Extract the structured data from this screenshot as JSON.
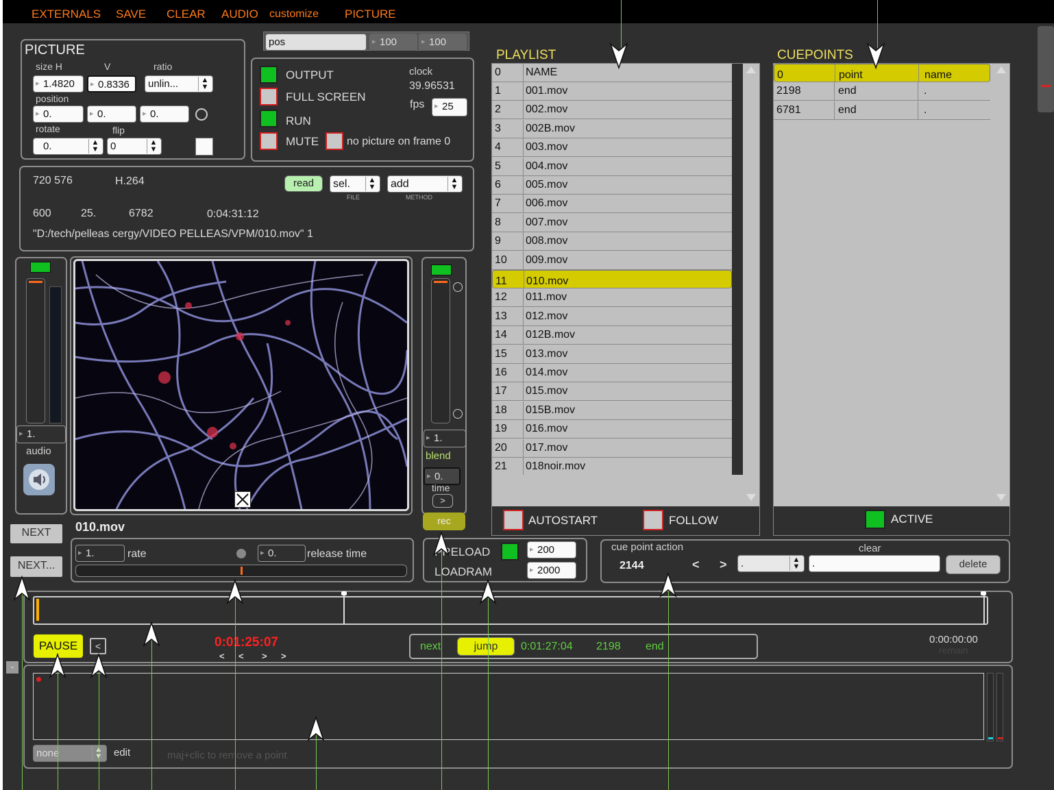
{
  "menu": [
    "EXTERNALS",
    "SAVE",
    "CLEAR",
    "AUDIO",
    "customize",
    "PICTURE"
  ],
  "picture": {
    "title": "PICTURE",
    "size_h_label": "size H",
    "v_label": "V",
    "ratio_label": "ratio",
    "size_h": "1.4820",
    "v": "0.8336",
    "ratio": "unlin...",
    "position_label": "position",
    "pos_x": "0.",
    "pos_y": "0.",
    "pos_z": "0.",
    "rotate_label": "rotate",
    "flip_label": "flip",
    "rotate": "0.",
    "flip": "0"
  },
  "posbar": {
    "mode": "pos",
    "a": "100",
    "b": "100"
  },
  "output": {
    "output_label": "OUTPUT",
    "fullscreen_label": "FULL SCREEN",
    "run_label": "RUN",
    "mute_label": "MUTE",
    "noframe_label": "no picture on frame 0",
    "clock_label": "clock",
    "clock_value": "39.96531",
    "fps_label": "fps",
    "fps_value": "25"
  },
  "info": {
    "resolution": "720 576",
    "codec": "H.264",
    "read_label": "read",
    "file_select": "sel.",
    "method_select": "add",
    "file_label": "FILE",
    "method_label": "METHOD",
    "v1": "600",
    "v2": "25.",
    "v3": "6782",
    "duration": "0:04:31:12",
    "path": "\"D:/tech/pelleas cergy/VIDEO PELLEAS/VPM/010.mov\" 1"
  },
  "audio": {
    "value": "1.",
    "label": "audio"
  },
  "blend": {
    "value": "1.",
    "label": "blend",
    "time_value": "0.",
    "time_label": "time",
    "arrow": ">",
    "rec_label": "rec"
  },
  "preview": {
    "filename": "010.mov"
  },
  "next_buttons": [
    "NEXT",
    "NEXT..."
  ],
  "rate": {
    "value": "1.",
    "label": "rate",
    "release_value": "0.",
    "release_label": "release time",
    "progress": 0.5
  },
  "preload": {
    "preload_label": "PRELOAD",
    "preload_value": "200",
    "loadram_label": "LOADRAM",
    "loadram_value": "2000"
  },
  "cue_action": {
    "title": "cue point action",
    "clear_label": "clear",
    "value": "2144",
    "prev": "<",
    "next": ">",
    "select": ".",
    "text": ".",
    "delete_label": "delete"
  },
  "playlist": {
    "title": "PLAYLIST",
    "header": [
      "0",
      "NAME"
    ],
    "rows": [
      [
        "1",
        "001.mov"
      ],
      [
        "2",
        "002.mov"
      ],
      [
        "3",
        "002B.mov"
      ],
      [
        "4",
        "003.mov"
      ],
      [
        "5",
        "004.mov"
      ],
      [
        "6",
        "005.mov"
      ],
      [
        "7",
        "006.mov"
      ],
      [
        "8",
        "007.mov"
      ],
      [
        "9",
        "008.mov"
      ],
      [
        "10",
        "009.mov"
      ],
      [
        "11",
        "010.mov"
      ],
      [
        "12",
        "011.mov"
      ],
      [
        "13",
        "012.mov"
      ],
      [
        "14",
        "012B.mov"
      ],
      [
        "15",
        "013.mov"
      ],
      [
        "16",
        "014.mov"
      ],
      [
        "17",
        "015.mov"
      ],
      [
        "18",
        "015B.mov"
      ],
      [
        "19",
        "016.mov"
      ],
      [
        "20",
        "017.mov"
      ],
      [
        "21",
        "018noir.mov"
      ]
    ],
    "selected_index": "11",
    "autostart_label": "AUTOSTART",
    "follow_label": "FOLLOW"
  },
  "cuepoints": {
    "title": "CUEPOINTS",
    "header": [
      "0",
      "point",
      "name"
    ],
    "rows": [
      [
        "2198",
        "end",
        "."
      ],
      [
        "6781",
        "end",
        "."
      ]
    ],
    "active_label": "ACTIVE"
  },
  "transport": {
    "pause_label": "PAUSE",
    "back_label": "<",
    "time": "0:01:25:07",
    "nav": [
      "<",
      "<",
      ">",
      ">"
    ],
    "next_label": "next",
    "jump_label": "jump",
    "next_time": "0:01:27:04",
    "next_frame": "2198",
    "next_action": "end",
    "remain_value": "0:00:00:00",
    "remain_label": "remain"
  },
  "automation": {
    "mode": "none",
    "edit_label": "edit",
    "hint": "maj+clic to remove a point"
  },
  "colors": {
    "accent_orange": "#ff7a1a",
    "green_on": "#10c020",
    "selection_yellow": "#d4cc00",
    "pause_yellow": "#e6f000",
    "annotation_green": "#7ac74f"
  }
}
